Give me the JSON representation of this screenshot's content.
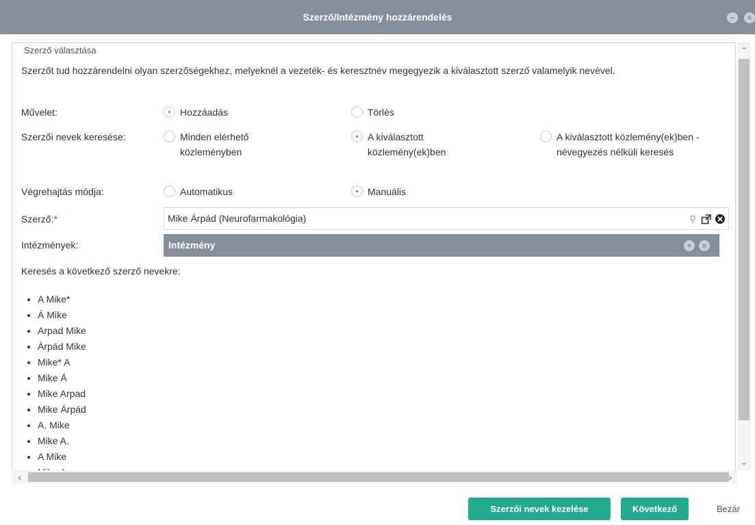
{
  "window": {
    "title": "Szerző/Intézmény hozzárendelés"
  },
  "section": {
    "legend": "Szerző választása",
    "description": "Szerzőt tud hozzárendelni olyan szerzőségekhez, melyeknél a vezeték- és keresztnév megegyezik a kiválasztott szerző valamelyik nevével."
  },
  "operation": {
    "label": "Művelet:",
    "options": [
      "Hozzáadás",
      "Törlés"
    ],
    "selected": "Hozzáadás"
  },
  "name_search": {
    "label": "Szerzői nevek keresése:",
    "options": [
      "Minden elérhető közleményben",
      "A kiválasztott közlemény(ek)ben",
      "A kiválasztott közlemény(ek)ben - névegyezés nélküli keresés"
    ],
    "selected": "A kiválasztott közlemény(ek)ben"
  },
  "execution": {
    "label": "Végrehajtás módja:",
    "options": [
      "Automatikus",
      "Manuális"
    ],
    "selected": "Manuális"
  },
  "author": {
    "label": "Szerző:",
    "required_mark": "*",
    "value": "Mike Árpád (Neurofarmakológia)"
  },
  "institutions": {
    "label": "Intézmények:",
    "header": "Intézmény"
  },
  "search_names": {
    "heading": "Keresés a következő szerző nevekre:",
    "items": [
      "A Mike*",
      "Á Mike",
      "Arpad Mike",
      "Árpád Mike",
      "Mike* A",
      "Mike Á",
      "Mike Arpad",
      "Mike Árpád",
      "A. Mike",
      "Mike A.",
      "A Mike",
      "Mike A"
    ]
  },
  "footer": {
    "manage_label": "Szerzői nevek kezelése",
    "next_label": "Következő",
    "close_label": "Bezár"
  },
  "colors": {
    "titlebar": "#858f9a",
    "primary_button": "#24aa8c",
    "required": "#e02020"
  },
  "icons": [
    "minimize-icon",
    "close-icon",
    "search-icon",
    "open-external-icon",
    "clear-icon",
    "add-icon",
    "remove-icon"
  ]
}
